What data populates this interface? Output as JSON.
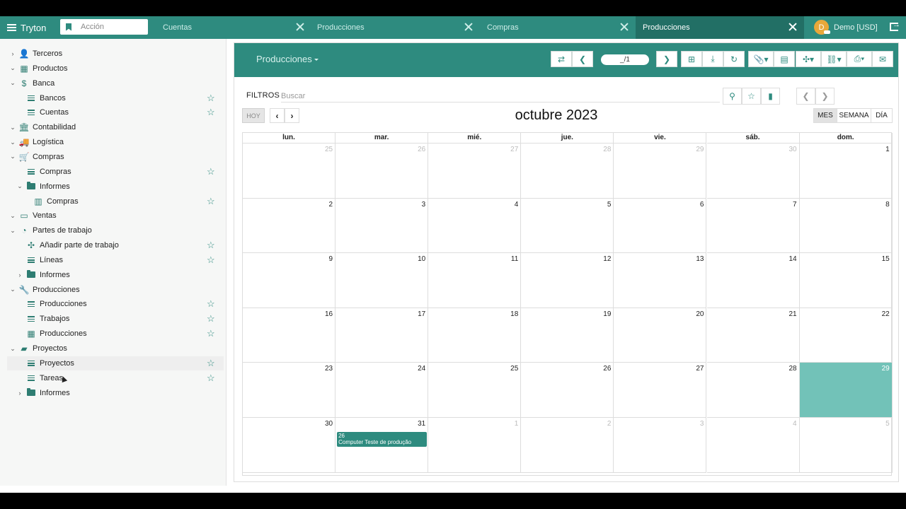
{
  "topbar": {
    "brand": "Tryton",
    "search_placeholder": "Acción",
    "tabs": [
      {
        "label": "Cuentas",
        "active": false
      },
      {
        "label": "Producciones",
        "active": false
      },
      {
        "label": "Compras",
        "active": false
      },
      {
        "label": "Producciones",
        "active": true
      }
    ],
    "user_initial": "D",
    "user_label": "Demo [USD]"
  },
  "sidebar": {
    "items": [
      {
        "label": "Terceros",
        "icon": "person-icon",
        "chevron": "right",
        "level": 0,
        "star": false
      },
      {
        "label": "Productos",
        "icon": "grid-icon",
        "chevron": "down",
        "level": 0,
        "star": false
      },
      {
        "label": "Banca",
        "icon": "money-icon",
        "chevron": "down",
        "level": 0,
        "star": false
      },
      {
        "label": "Bancos",
        "icon": "list-icon",
        "chevron": "",
        "level": 1,
        "star": true
      },
      {
        "label": "Cuentas",
        "icon": "list-icon",
        "chevron": "",
        "level": 1,
        "star": true
      },
      {
        "label": "Contabilidad",
        "icon": "bank-icon",
        "chevron": "down",
        "level": 0,
        "star": false
      },
      {
        "label": "Logística",
        "icon": "truck-icon",
        "chevron": "down",
        "level": 0,
        "star": false
      },
      {
        "label": "Compras",
        "icon": "cart-icon",
        "chevron": "down",
        "level": 0,
        "star": false
      },
      {
        "label": "Compras",
        "icon": "list-icon",
        "chevron": "",
        "level": 1,
        "star": true
      },
      {
        "label": "Informes",
        "icon": "folder-icon",
        "chevron": "down",
        "level": 1,
        "star": false
      },
      {
        "label": "Compras",
        "icon": "chart-icon",
        "chevron": "",
        "level": 2,
        "star": true
      },
      {
        "label": "Ventas",
        "icon": "store-icon",
        "chevron": "down",
        "level": 0,
        "star": false
      },
      {
        "label": "Partes de trabajo",
        "icon": "timer-icon",
        "chevron": "down",
        "level": 0,
        "star": false
      },
      {
        "label": "Añadir parte de trabajo",
        "icon": "wizard-icon",
        "chevron": "",
        "level": 1,
        "star": true
      },
      {
        "label": "Líneas",
        "icon": "list-icon",
        "chevron": "",
        "level": 1,
        "star": true
      },
      {
        "label": "Informes",
        "icon": "folder-icon",
        "chevron": "right",
        "level": 1,
        "star": false
      },
      {
        "label": "Producciones",
        "icon": "wrench-icon",
        "chevron": "down",
        "level": 0,
        "star": false
      },
      {
        "label": "Producciones",
        "icon": "list-icon",
        "chevron": "",
        "level": 1,
        "star": true
      },
      {
        "label": "Trabajos",
        "icon": "list-icon",
        "chevron": "",
        "level": 1,
        "star": true
      },
      {
        "label": "Producciones",
        "icon": "calendar-icon",
        "chevron": "",
        "level": 1,
        "star": true
      },
      {
        "label": "Proyectos",
        "icon": "briefcase-icon",
        "chevron": "down",
        "level": 0,
        "star": false
      },
      {
        "label": "Proyectos",
        "icon": "list-icon",
        "chevron": "",
        "level": 1,
        "star": true,
        "highlight": true
      },
      {
        "label": "Tareas",
        "icon": "list-icon",
        "chevron": "",
        "level": 1,
        "star": true
      },
      {
        "label": "Informes",
        "icon": "folder-icon",
        "chevron": "right",
        "level": 1,
        "star": false
      }
    ]
  },
  "main": {
    "title": "Producciones",
    "pager": "_/1",
    "filters_label": "FILTROS",
    "search_placeholder": "Buscar"
  },
  "calendar": {
    "today_label": "HOY",
    "title": "octubre 2023",
    "views": [
      "MES",
      "SEMANA",
      "DÍA"
    ],
    "active_view": "MES",
    "weekdays": [
      "lun.",
      "mar.",
      "mié.",
      "jue.",
      "vie.",
      "sáb.",
      "dom."
    ],
    "weeks": [
      [
        {
          "d": "25",
          "o": true
        },
        {
          "d": "26",
          "o": true
        },
        {
          "d": "27",
          "o": true
        },
        {
          "d": "28",
          "o": true
        },
        {
          "d": "29",
          "o": true
        },
        {
          "d": "30",
          "o": true
        },
        {
          "d": "1",
          "o": false
        }
      ],
      [
        {
          "d": "2",
          "o": false
        },
        {
          "d": "3",
          "o": false
        },
        {
          "d": "4",
          "o": false
        },
        {
          "d": "5",
          "o": false
        },
        {
          "d": "6",
          "o": false
        },
        {
          "d": "7",
          "o": false
        },
        {
          "d": "8",
          "o": false
        }
      ],
      [
        {
          "d": "9",
          "o": false
        },
        {
          "d": "10",
          "o": false
        },
        {
          "d": "11",
          "o": false
        },
        {
          "d": "12",
          "o": false
        },
        {
          "d": "13",
          "o": false
        },
        {
          "d": "14",
          "o": false
        },
        {
          "d": "15",
          "o": false
        }
      ],
      [
        {
          "d": "16",
          "o": false
        },
        {
          "d": "17",
          "o": false
        },
        {
          "d": "18",
          "o": false
        },
        {
          "d": "19",
          "o": false
        },
        {
          "d": "20",
          "o": false
        },
        {
          "d": "21",
          "o": false
        },
        {
          "d": "22",
          "o": false
        }
      ],
      [
        {
          "d": "23",
          "o": false
        },
        {
          "d": "24",
          "o": false
        },
        {
          "d": "25",
          "o": false
        },
        {
          "d": "26",
          "o": false
        },
        {
          "d": "27",
          "o": false
        },
        {
          "d": "28",
          "o": false
        },
        {
          "d": "29",
          "o": false,
          "today": true
        }
      ],
      [
        {
          "d": "30",
          "o": false
        },
        {
          "d": "31",
          "o": false
        },
        {
          "d": "1",
          "o": true
        },
        {
          "d": "2",
          "o": true
        },
        {
          "d": "3",
          "o": true
        },
        {
          "d": "4",
          "o": true
        },
        {
          "d": "5",
          "o": true
        }
      ]
    ],
    "event": {
      "week": 5,
      "day": 1,
      "line1": "26",
      "line2": "Computer Teste de produção"
    }
  },
  "colors": {
    "primary": "#2e8b7f",
    "today": "#72c2b8",
    "active_tab": "#226f65"
  }
}
